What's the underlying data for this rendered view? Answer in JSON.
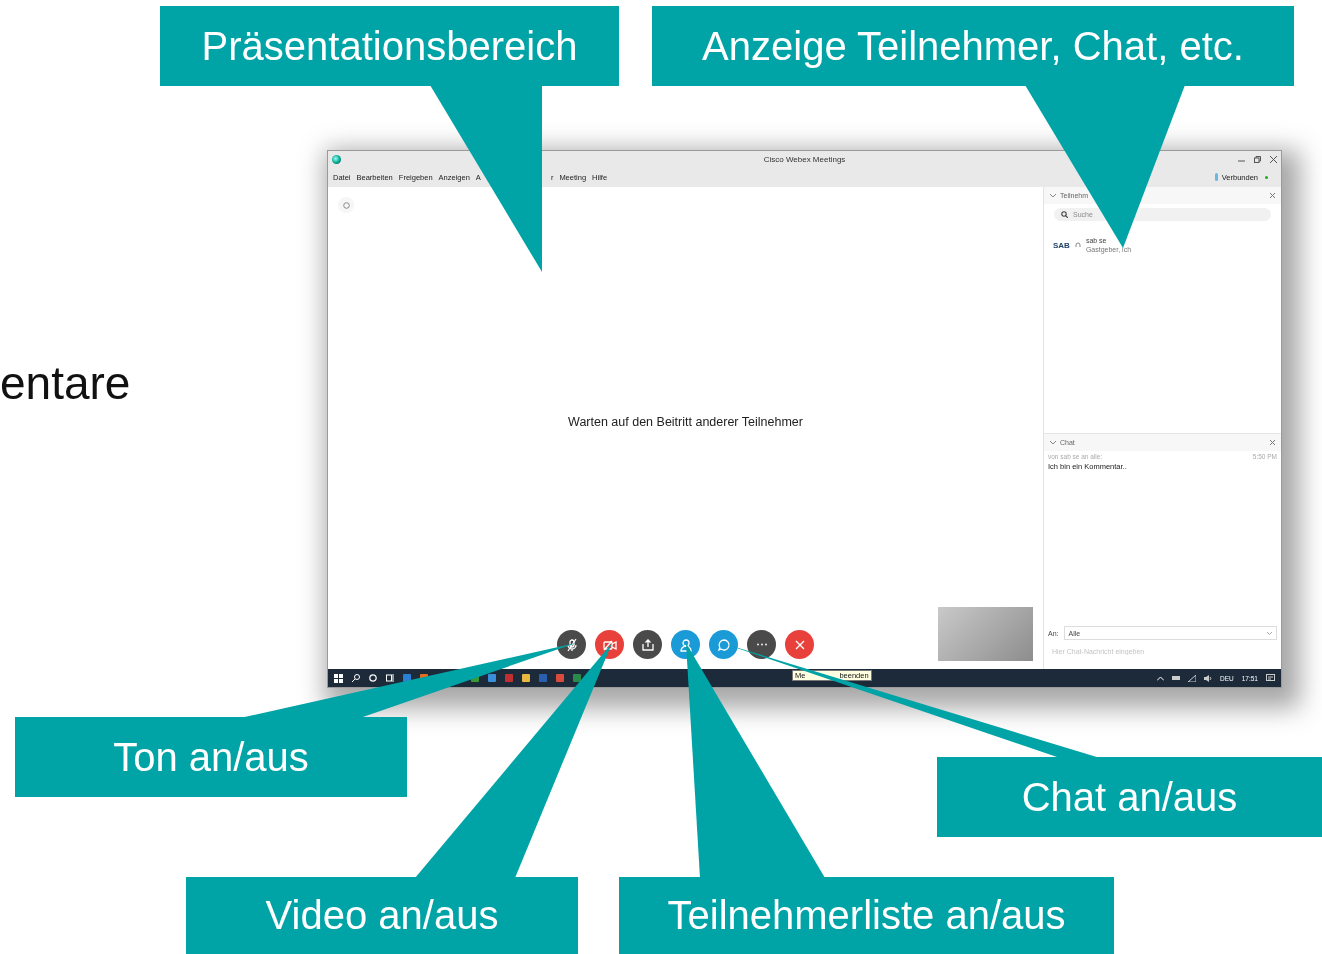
{
  "slide": {
    "cut_text": "entare"
  },
  "window": {
    "title": "Cisco Webex Meetings",
    "status": "Verbunden",
    "menu": [
      "Datei",
      "Bearbeiten",
      "Freigeben",
      "Anzeigen",
      "A",
      "r",
      "Meeting",
      "Hilfe"
    ],
    "stage_message": "Warten auf den Beitritt anderer Teilnehmer",
    "controls": [
      {
        "kind": "mic",
        "color": "#4a4a4a"
      },
      {
        "kind": "video",
        "color": "#e8403a"
      },
      {
        "kind": "share",
        "color": "#4a4a4a"
      },
      {
        "kind": "participants",
        "color": "#1a9bd8"
      },
      {
        "kind": "chat",
        "color": "#1a9bd8"
      },
      {
        "kind": "more",
        "color": "#4a4a4a"
      },
      {
        "kind": "end",
        "color": "#e8403a"
      }
    ],
    "tooltip": [
      "Me",
      "beenden"
    ],
    "participants_panel": {
      "title": "Teilnehm",
      "search": {
        "placeholder": "Suche"
      },
      "participants": [
        {
          "avatar": "SAB",
          "name": "sab se",
          "role": "Gastgeber, ich"
        }
      ]
    },
    "chat_panel": {
      "title": "Chat",
      "messages": [
        {
          "from": "von sab se an alle:",
          "time": "5:50 PM",
          "text": "Ich bin ein Kommentar.."
        }
      ],
      "to_label": "An:",
      "to_value": "Alle",
      "input": {
        "placeholder": "Hier Chat-Nachricht eingeben"
      }
    },
    "taskbar": {
      "language": "DEU",
      "time": "17:51"
    }
  },
  "callouts": [
    {
      "label": "Präsentationsbereich"
    },
    {
      "label": "Anzeige Teilnehmer, Chat, etc."
    },
    {
      "label": "Ton an/aus"
    },
    {
      "label": "Video an/aus"
    },
    {
      "label": "Teilnehmerliste an/aus"
    },
    {
      "label": "Chat an/aus"
    }
  ]
}
